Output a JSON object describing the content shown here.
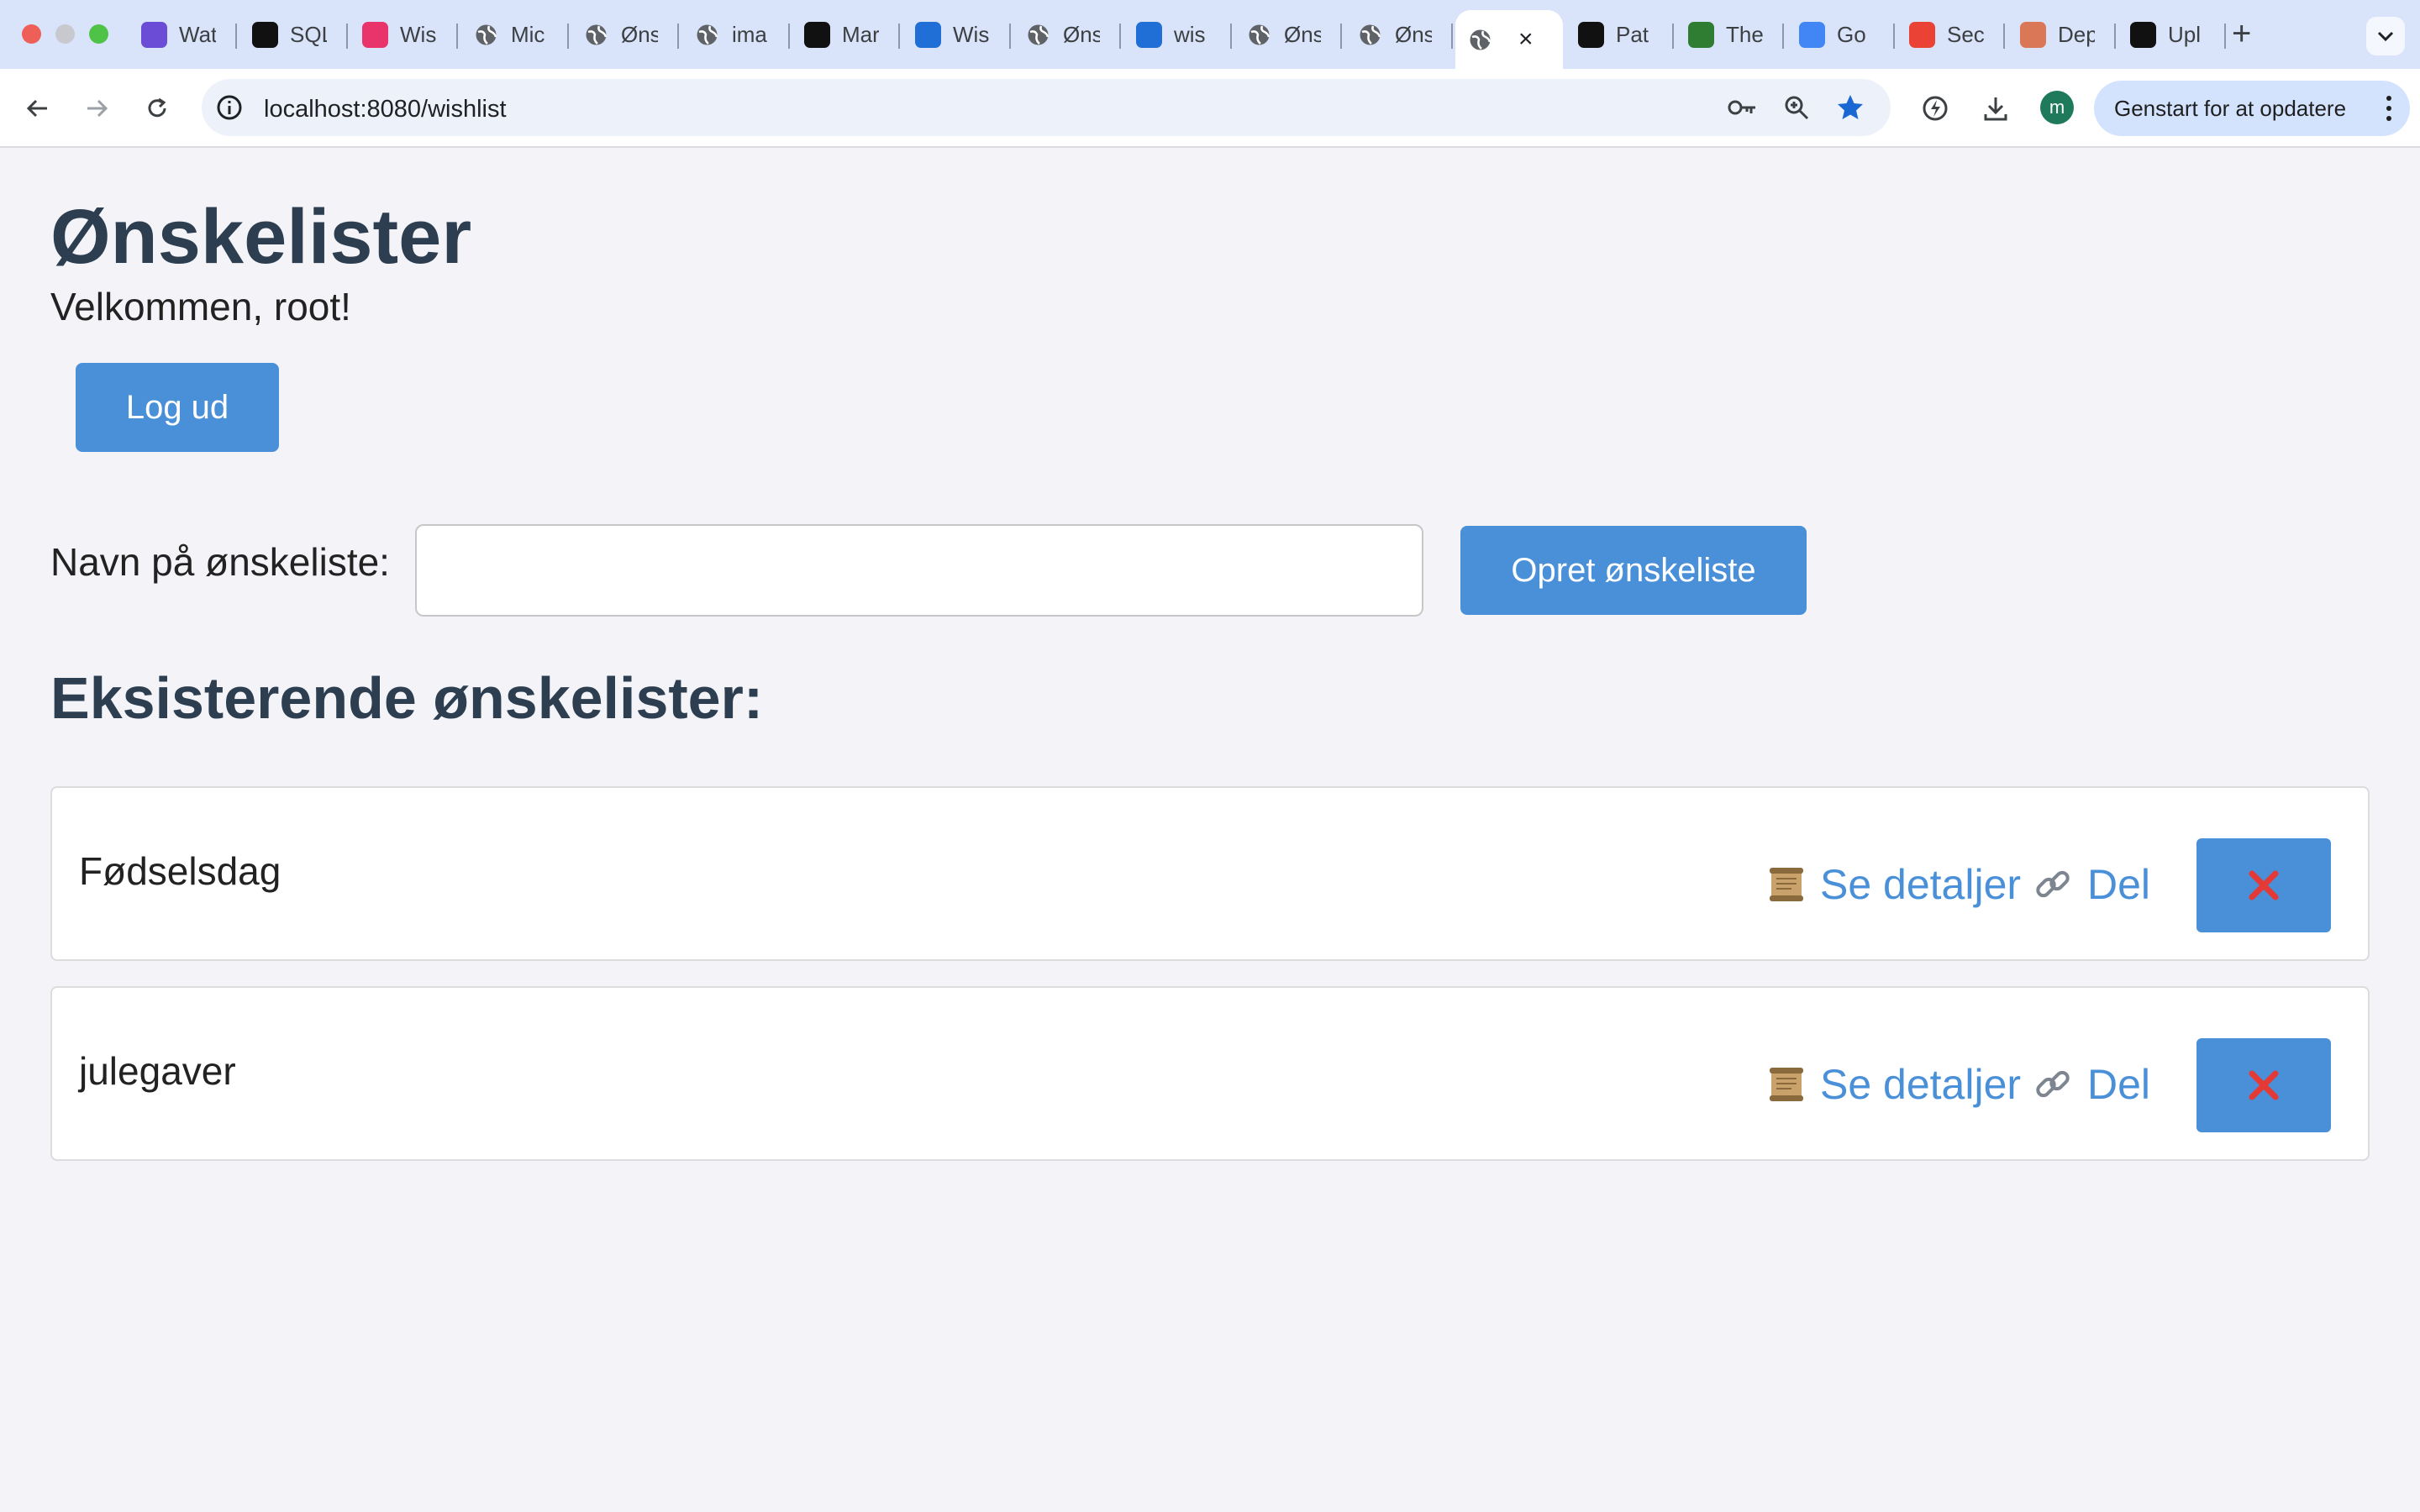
{
  "browser": {
    "tabs": [
      {
        "title": "Wat",
        "icon": "video-app-icon",
        "color": "#6b4cd6"
      },
      {
        "title": "SQL",
        "icon": "openai-icon",
        "color": "#111111"
      },
      {
        "title": "Wis",
        "icon": "jetbrains-icon",
        "color": "#e8336b"
      },
      {
        "title": "Mic",
        "icon": "globe-icon",
        "color": "#5f6368"
      },
      {
        "title": "Øns",
        "icon": "globe-icon",
        "color": "#5f6368"
      },
      {
        "title": "ima",
        "icon": "globe-icon",
        "color": "#5f6368"
      },
      {
        "title": "Mar",
        "icon": "github-icon",
        "color": "#111111"
      },
      {
        "title": "Wis",
        "icon": "azure-icon",
        "color": "#1f6fd6"
      },
      {
        "title": "Øns",
        "icon": "globe-icon",
        "color": "#5f6368"
      },
      {
        "title": "wis",
        "icon": "azure-icon",
        "color": "#1f6fd6"
      },
      {
        "title": "Øns",
        "icon": "globe-icon",
        "color": "#5f6368"
      },
      {
        "title": "Øns",
        "icon": "globe-icon",
        "color": "#5f6368"
      },
      {
        "title": "",
        "icon": "globe-icon",
        "color": "#5f6368",
        "active": true
      },
      {
        "title": "Pat",
        "icon": "icy-icon",
        "color": "#111111"
      },
      {
        "title": "The",
        "icon": "leaf-icon",
        "color": "#2e7d32"
      },
      {
        "title": "Go",
        "icon": "google-icon",
        "color": "#4285f4"
      },
      {
        "title": "Sec",
        "icon": "gmail-icon",
        "color": "#ea4335"
      },
      {
        "title": "Dep",
        "icon": "claude-icon",
        "color": "#d97757"
      },
      {
        "title": "Upl",
        "icon": "github-icon",
        "color": "#111111"
      }
    ],
    "url": "localhost:8080/wishlist",
    "avatar_letter": "m",
    "update_label": "Genstart for at opdatere"
  },
  "page": {
    "title": "Ønskelister",
    "welcome": "Velkommen, root!",
    "logout_label": "Log ud",
    "name_label": "Navn på ønskeliste:",
    "name_value": "",
    "create_label": "Opret ønskeliste",
    "existing_heading": "Eksisterende ønskelister:",
    "wishlists": [
      {
        "name": "Fødselsdag",
        "details_label": "Se detaljer",
        "share_label": "Del",
        "delete_symbol": "✕"
      },
      {
        "name": "julegaver",
        "details_label": "Se detaljer",
        "share_label": "Del",
        "delete_symbol": "✕"
      }
    ]
  },
  "colors": {
    "accent": "#4a90d9",
    "heading": "#2c3e50",
    "delete_x": "#e53935",
    "page_bg": "#f3f3f8"
  }
}
